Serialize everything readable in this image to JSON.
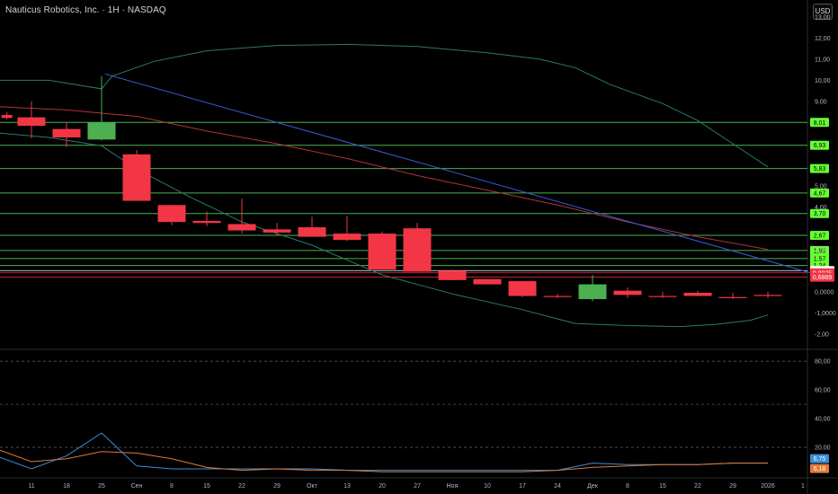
{
  "header": {
    "title": "Nauticus Robotics, Inc. · 1H · NASDAQ",
    "currency": "USD"
  },
  "chart_data": [
    {
      "type": "candlestick",
      "ylim": [
        -2.6,
        13.8
      ],
      "y_ticks": [
        {
          "v": 13,
          "label": "13,00"
        },
        {
          "v": 12,
          "label": "12,00"
        },
        {
          "v": 11,
          "label": "11,00"
        },
        {
          "v": 10,
          "label": "10,00"
        },
        {
          "v": 9,
          "label": "9,00"
        },
        {
          "v": 5,
          "label": "5,00"
        },
        {
          "v": 4,
          "label": "4,00"
        },
        {
          "v": 2,
          "label": "2,00"
        },
        {
          "v": 0,
          "label": "0,0000"
        },
        {
          "v": -1,
          "label": "-1,0000"
        },
        {
          "v": -2,
          "label": "-2,00"
        }
      ],
      "x_ticks": [
        {
          "i": 0,
          "label": "11"
        },
        {
          "i": 1,
          "label": "18"
        },
        {
          "i": 2,
          "label": "25"
        },
        {
          "i": 3,
          "label": "Сен"
        },
        {
          "i": 4,
          "label": "8"
        },
        {
          "i": 5,
          "label": "15"
        },
        {
          "i": 6,
          "label": "22"
        },
        {
          "i": 7,
          "label": "29"
        },
        {
          "i": 8,
          "label": "Окт"
        },
        {
          "i": 9,
          "label": "13"
        },
        {
          "i": 10,
          "label": "20"
        },
        {
          "i": 11,
          "label": "27"
        },
        {
          "i": 12,
          "label": "Ноя"
        },
        {
          "i": 13,
          "label": "10"
        },
        {
          "i": 14,
          "label": "17"
        },
        {
          "i": 15,
          "label": "24"
        },
        {
          "i": 16,
          "label": "Дек"
        },
        {
          "i": 17,
          "label": "8"
        },
        {
          "i": 18,
          "label": "15"
        },
        {
          "i": 19,
          "label": "22"
        },
        {
          "i": 20,
          "label": "29"
        },
        {
          "i": 21,
          "label": "2026"
        },
        {
          "i": 22,
          "label": "1"
        }
      ],
      "candles": [
        {
          "i": -0.7,
          "o": 8.36,
          "h": 8.5,
          "l": 8.15,
          "c": 8.22
        },
        {
          "i": 0,
          "o": 8.25,
          "h": 9.0,
          "l": 7.25,
          "c": 7.85
        },
        {
          "i": 1,
          "o": 7.7,
          "h": 8.0,
          "l": 6.85,
          "c": 7.3
        },
        {
          "i": 2,
          "o": 7.2,
          "h": 10.2,
          "l": 7.15,
          "c": 8.01
        },
        {
          "i": 3,
          "o": 6.5,
          "h": 6.7,
          "l": 4.35,
          "c": 4.3
        },
        {
          "i": 4,
          "o": 4.1,
          "h": 4.1,
          "l": 3.15,
          "c": 3.3
        },
        {
          "i": 5,
          "o": 3.35,
          "h": 3.8,
          "l": 3.1,
          "c": 3.25
        },
        {
          "i": 6,
          "o": 3.2,
          "h": 4.4,
          "l": 2.75,
          "c": 2.9
        },
        {
          "i": 7,
          "o": 2.95,
          "h": 3.25,
          "l": 2.65,
          "c": 2.8
        },
        {
          "i": 8,
          "o": 3.05,
          "h": 3.55,
          "l": 2.6,
          "c": 2.6
        },
        {
          "i": 9,
          "o": 2.75,
          "h": 3.6,
          "l": 2.4,
          "c": 2.45
        },
        {
          "i": 10,
          "o": 2.75,
          "h": 2.85,
          "l": 1.05,
          "c": 1.05
        },
        {
          "i": 11,
          "o": 3.0,
          "h": 3.25,
          "l": 0.95,
          "c": 0.95
        },
        {
          "i": 12,
          "o": 1.0,
          "h": 1.05,
          "l": 0.55,
          "c": 0.55
        },
        {
          "i": 13,
          "o": 0.6,
          "h": 0.6,
          "l": 0.35,
          "c": 0.35
        },
        {
          "i": 14,
          "o": 0.5,
          "h": 0.5,
          "l": -0.25,
          "c": -0.2
        },
        {
          "i": 15,
          "o": -0.2,
          "h": -0.1,
          "l": -0.3,
          "c": -0.25
        },
        {
          "i": 16,
          "o": -0.35,
          "h": 0.8,
          "l": -0.45,
          "c": 0.35
        },
        {
          "i": 17,
          "o": 0.05,
          "h": 0.2,
          "l": -0.3,
          "c": -0.15
        },
        {
          "i": 18,
          "o": -0.2,
          "h": 0.0,
          "l": -0.3,
          "c": -0.25
        },
        {
          "i": 19,
          "o": -0.05,
          "h": 0.05,
          "l": -0.2,
          "c": -0.2
        },
        {
          "i": 20,
          "o": -0.25,
          "h": -0.05,
          "l": -0.35,
          "c": -0.3
        },
        {
          "i": 21,
          "o": -0.15,
          "h": 0.0,
          "l": -0.3,
          "c": -0.2
        }
      ],
      "levels": [
        {
          "v": 8.01,
          "label": "8,01"
        },
        {
          "v": 6.93,
          "label": "6,93"
        },
        {
          "v": 5.83,
          "label": "5,83"
        },
        {
          "v": 4.67,
          "label": "4,67"
        },
        {
          "v": 3.7,
          "label": "3,70"
        },
        {
          "v": 2.67,
          "label": "2,67"
        },
        {
          "v": 1.95,
          "label": "1,95"
        },
        {
          "v": 1.57,
          "label": "1,57"
        },
        {
          "v": 1.24,
          "label": "1,24"
        }
      ],
      "level_color": "#4caf50",
      "level_label_bg": "#66ff33",
      "price_badges": [
        {
          "v": 0.9993,
          "label": "0,9993",
          "bg": "#ffffff",
          "fg": "#000000",
          "line": "#ffffff"
        },
        {
          "v": 0.8935,
          "label": "0,8935",
          "bg": "#f23645",
          "fg": "#ffffff",
          "line": "#f23645"
        },
        {
          "v": 0.6889,
          "label": "0,6889",
          "bg": "#f23645",
          "fg": "#ffffff",
          "line": "#f23645"
        }
      ],
      "bands": {
        "color": "#2b7a69",
        "upper": [
          [
            -0.9,
            10.0
          ],
          [
            0.5,
            10.0
          ],
          [
            2.0,
            9.6
          ],
          [
            2.3,
            10.2
          ],
          [
            3.5,
            10.9
          ],
          [
            5,
            11.4
          ],
          [
            7,
            11.65
          ],
          [
            9,
            11.7
          ],
          [
            11,
            11.6
          ],
          [
            13,
            11.3
          ],
          [
            14.5,
            11.0
          ],
          [
            15.5,
            10.6
          ],
          [
            16.5,
            9.8
          ],
          [
            18,
            8.9
          ],
          [
            19,
            8.1
          ],
          [
            20,
            7.0
          ],
          [
            21,
            5.9
          ]
        ],
        "lower": [
          [
            -0.9,
            7.5
          ],
          [
            0.5,
            7.3
          ],
          [
            2.0,
            6.9
          ],
          [
            3.0,
            5.8
          ],
          [
            4.5,
            4.5
          ],
          [
            6,
            3.3
          ],
          [
            8,
            2.2
          ],
          [
            10,
            0.8
          ],
          [
            12,
            -0.1
          ],
          [
            14,
            -0.85
          ],
          [
            15.5,
            -1.5
          ],
          [
            17,
            -1.6
          ],
          [
            18.5,
            -1.65
          ],
          [
            19.5,
            -1.55
          ],
          [
            20.5,
            -1.35
          ],
          [
            21,
            -1.1
          ]
        ]
      },
      "moving_average": {
        "color": "#b2323a",
        "points": [
          [
            -0.9,
            8.75
          ],
          [
            1,
            8.6
          ],
          [
            3,
            8.3
          ],
          [
            5,
            7.6
          ],
          [
            7,
            7.0
          ],
          [
            9,
            6.3
          ],
          [
            11,
            5.5
          ],
          [
            13,
            4.8
          ],
          [
            15,
            4.1
          ],
          [
            17,
            3.3
          ],
          [
            19,
            2.6
          ],
          [
            21,
            2.0
          ]
        ]
      },
      "trend_line": {
        "color": "#3a5bd9",
        "points": [
          [
            2.1,
            10.3
          ],
          [
            22.2,
            0.9
          ]
        ]
      }
    },
    {
      "type": "line",
      "ylim": [
        0,
        87
      ],
      "y_ticks": [
        {
          "v": 80,
          "label": "80,00"
        },
        {
          "v": 60,
          "label": "60,00"
        },
        {
          "v": 40,
          "label": "40,00"
        },
        {
          "v": 20,
          "label": "20,00"
        }
      ],
      "dashed_levels": [
        80,
        50,
        20
      ],
      "series": [
        {
          "color": "#3a8fd6",
          "label": "6,75",
          "label_bg": "#3a8fd6",
          "points": [
            [
              -0.9,
              13
            ],
            [
              0,
              5
            ],
            [
              1,
              14
            ],
            [
              2,
              30
            ],
            [
              3,
              7
            ],
            [
              4,
              5
            ],
            [
              5,
              5
            ],
            [
              6,
              5
            ],
            [
              7,
              5
            ],
            [
              8,
              5
            ],
            [
              9,
              4
            ],
            [
              10,
              4
            ],
            [
              11,
              4
            ],
            [
              12,
              4
            ],
            [
              13,
              4
            ],
            [
              14,
              4
            ],
            [
              15,
              4
            ],
            [
              16,
              9
            ],
            [
              17,
              8
            ],
            [
              18,
              8
            ],
            [
              19,
              8
            ],
            [
              20,
              9
            ],
            [
              21,
              9
            ]
          ]
        },
        {
          "color": "#e07a3a",
          "label": "6,18",
          "label_bg": "#e07a3a",
          "points": [
            [
              -0.9,
              18
            ],
            [
              0,
              10
            ],
            [
              1,
              12
            ],
            [
              2,
              17
            ],
            [
              3,
              16
            ],
            [
              4,
              12
            ],
            [
              5,
              6
            ],
            [
              6,
              4
            ],
            [
              7,
              5
            ],
            [
              8,
              4
            ],
            [
              9,
              4
            ],
            [
              10,
              3
            ],
            [
              11,
              3
            ],
            [
              12,
              3
            ],
            [
              13,
              3
            ],
            [
              14,
              3
            ],
            [
              15,
              4
            ],
            [
              16,
              6
            ],
            [
              17,
              7
            ],
            [
              18,
              8
            ],
            [
              19,
              8
            ],
            [
              20,
              9
            ],
            [
              21,
              9
            ]
          ]
        }
      ]
    }
  ]
}
